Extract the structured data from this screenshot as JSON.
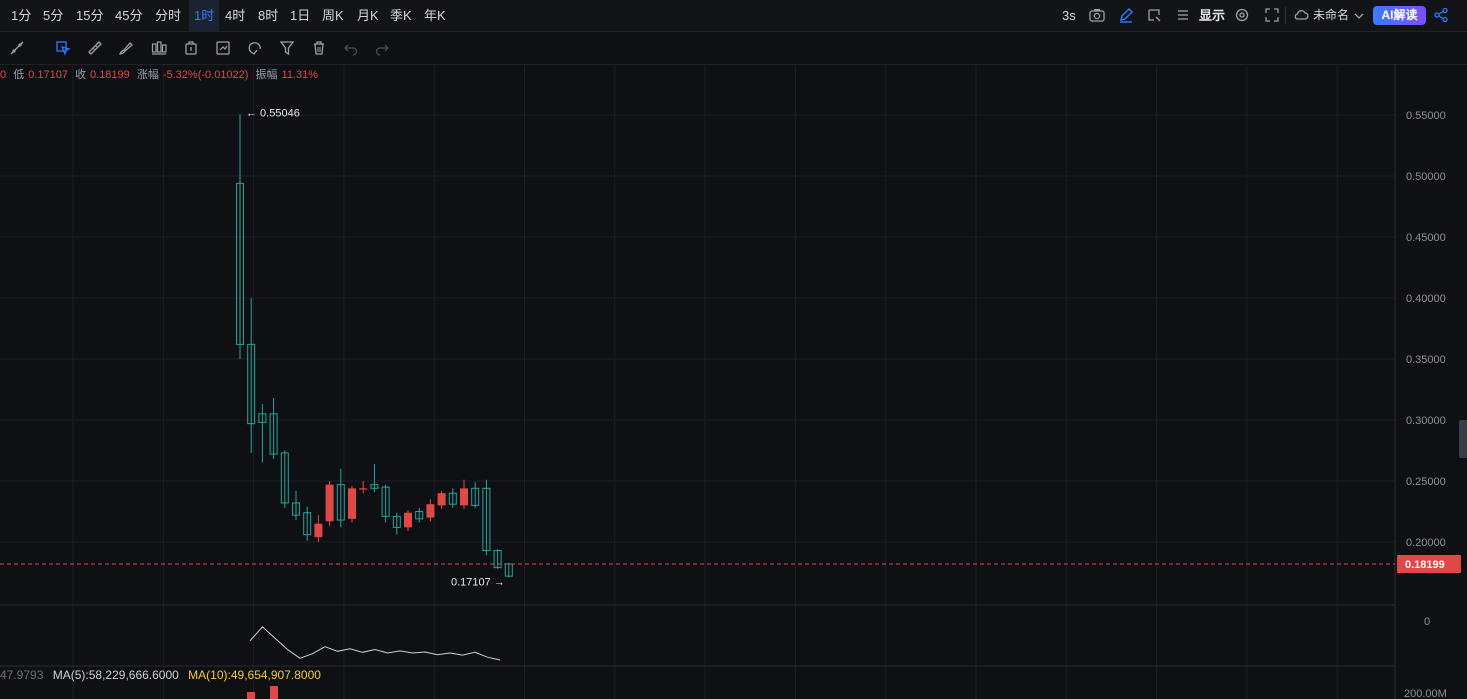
{
  "periods": [
    "1分",
    "5分",
    "15分",
    "45分",
    "分时",
    "1时",
    "4时",
    "8时",
    "1日",
    "周K",
    "月K",
    "季K",
    "年K"
  ],
  "active_period": "1时",
  "top_right": {
    "refresh": "3s",
    "display_label": "显示",
    "layout_name": "未命名",
    "ai_label": "AI解读"
  },
  "ohlc": {
    "prefix": "0",
    "low_label": "低",
    "low": "0.17107",
    "close_label": "收",
    "close": "0.18199",
    "change_label": "涨幅",
    "change": "-5.32%(-0.01022)",
    "amp_label": "振幅",
    "amp": "11.31%"
  },
  "colors": {
    "up": "#e04848",
    "down": "#26a69a",
    "ma": "#d0d0d0",
    "ma10": "#f5c842",
    "accent": "#2f7bff"
  },
  "chart_data": {
    "type": "candlestick",
    "y_ticks": [
      "0.55000",
      "0.50000",
      "0.45000",
      "0.40000",
      "0.35000",
      "0.30000",
      "0.25000",
      "0.20000"
    ],
    "ylim": [
      0.1775,
      0.5965
    ],
    "last_price": "0.18199",
    "high_marker": "0.55046",
    "low_marker": "0.17107",
    "candles": [
      {
        "o": 0.362,
        "c": 0.494,
        "h": 0.5505,
        "l": 0.35
      },
      {
        "o": 0.297,
        "c": 0.362,
        "h": 0.4,
        "l": 0.273
      },
      {
        "o": 0.298,
        "c": 0.305,
        "h": 0.313,
        "l": 0.265
      },
      {
        "o": 0.272,
        "c": 0.305,
        "h": 0.318,
        "l": 0.268
      },
      {
        "o": 0.232,
        "c": 0.273,
        "h": 0.275,
        "l": 0.228
      },
      {
        "o": 0.222,
        "c": 0.232,
        "h": 0.242,
        "l": 0.218
      },
      {
        "o": 0.206,
        "c": 0.224,
        "h": 0.229,
        "l": 0.201
      },
      {
        "o": 0.215,
        "c": 0.204,
        "h": 0.222,
        "l": 0.2
      },
      {
        "o": 0.247,
        "c": 0.217,
        "h": 0.25,
        "l": 0.213
      },
      {
        "o": 0.218,
        "c": 0.247,
        "h": 0.26,
        "l": 0.212
      },
      {
        "o": 0.244,
        "c": 0.219,
        "h": 0.246,
        "l": 0.216
      },
      {
        "o": 0.244,
        "c": 0.243,
        "h": 0.25,
        "l": 0.24
      },
      {
        "o": 0.244,
        "c": 0.247,
        "h": 0.264,
        "l": 0.241
      },
      {
        "o": 0.221,
        "c": 0.245,
        "h": 0.247,
        "l": 0.216
      },
      {
        "o": 0.212,
        "c": 0.221,
        "h": 0.224,
        "l": 0.206
      },
      {
        "o": 0.224,
        "c": 0.212,
        "h": 0.226,
        "l": 0.209
      },
      {
        "o": 0.219,
        "c": 0.225,
        "h": 0.228,
        "l": 0.216
      },
      {
        "o": 0.231,
        "c": 0.22,
        "h": 0.235,
        "l": 0.217
      },
      {
        "o": 0.24,
        "c": 0.23,
        "h": 0.242,
        "l": 0.227
      },
      {
        "o": 0.231,
        "c": 0.24,
        "h": 0.244,
        "l": 0.228
      },
      {
        "o": 0.244,
        "c": 0.23,
        "h": 0.251,
        "l": 0.227
      },
      {
        "o": 0.23,
        "c": 0.244,
        "h": 0.249,
        "l": 0.228
      },
      {
        "o": 0.193,
        "c": 0.244,
        "h": 0.251,
        "l": 0.189
      },
      {
        "o": 0.179,
        "c": 0.193,
        "h": 0.194,
        "l": 0.178
      },
      {
        "o": 0.172,
        "c": 0.182,
        "h": 0.183,
        "l": 0.171
      }
    ],
    "indicator": {
      "zero_label": "0",
      "values": [
        0.55,
        0.95,
        0.62,
        0.3,
        0.05,
        0.18,
        0.38,
        0.25,
        0.32,
        0.22,
        0.3,
        0.2,
        0.26,
        0.2,
        0.23,
        0.15,
        0.2,
        0.14,
        0.22,
        0.08,
        0.0
      ]
    },
    "volume": {
      "ma_prefix_value": "47.9793",
      "ma5": "MA(5):58,229,666.6000",
      "ma10": "MA(10):49,654,907.8000",
      "y_label": "200.00M"
    }
  }
}
